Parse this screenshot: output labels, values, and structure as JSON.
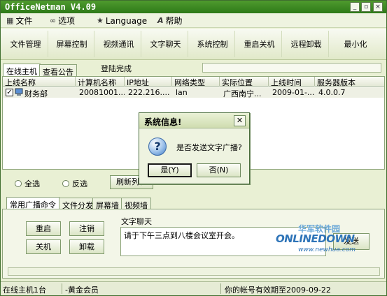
{
  "app": {
    "title": "OfficeNetman V4.09",
    "window_controls": [
      "_",
      "▫",
      "×"
    ]
  },
  "menu": [
    {
      "label": "文件",
      "icon": "file-icon"
    },
    {
      "label": "选项",
      "icon": "options-icon"
    },
    {
      "label": "Language",
      "icon": "language-icon"
    },
    {
      "label": "帮助",
      "icon": "help-icon"
    }
  ],
  "toolbar": [
    "文件管理",
    "屏幕控制",
    "视频通讯",
    "文字聊天",
    "系统控制",
    "重启关机",
    "远程卸载",
    "最小化"
  ],
  "top_tabs": [
    "在线主机",
    "查看公告"
  ],
  "login_status": "登陆完成",
  "table": {
    "headers": [
      "上线名称",
      "计算机名称",
      "IP地址",
      "网络类型",
      "实际位置",
      "上线时间",
      "服务器版本"
    ],
    "rows": [
      [
        "财务部",
        "20081001...",
        "222.216....",
        "lan",
        "广西南宁...",
        "2009-01-...",
        "4.0.0.7"
      ]
    ]
  },
  "selection": {
    "select_all": "全选",
    "invert": "反选",
    "refresh": "刷新列表"
  },
  "bottom_tabs": [
    "常用广播命令",
    "文件分发",
    "屏幕墙",
    "视频墙"
  ],
  "commands": [
    "重启",
    "注销",
    "关机",
    "卸载"
  ],
  "chat": {
    "label": "文字聊天",
    "message": "请于下午三点到八楼会议室开会。",
    "send": "发送"
  },
  "status_bar": {
    "online": "在线主机1台",
    "member": "-黄金会员",
    "expiry": "你的帐号有效期至2009-09-22"
  },
  "dialog": {
    "title": "系统信息!",
    "message": "是否发送文字广播?",
    "yes": "是(Y)",
    "no": "否(N)",
    "icon": "question-icon"
  },
  "watermark": {
    "cn": "华军软件园",
    "en": "ONLINEDOWN",
    "url": "www.newhua.com"
  },
  "colors": {
    "title_bar": "#2d7a18",
    "window_bg": "#e9f0d4",
    "selected_row": "#eef0e4"
  }
}
